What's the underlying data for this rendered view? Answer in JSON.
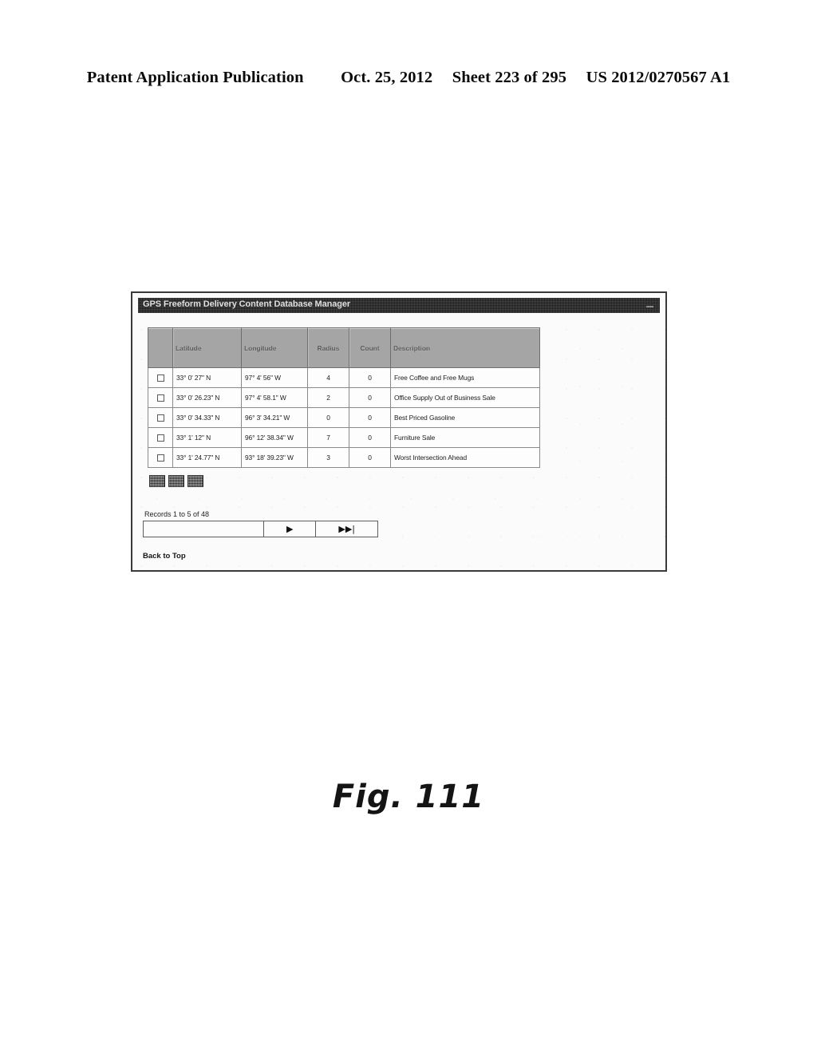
{
  "page_header": {
    "publication": "Patent Application Publication",
    "date": "Oct. 25, 2012",
    "sheet": "Sheet 223 of 295",
    "patent_number": "US 2012/0270567 A1"
  },
  "figure": {
    "caption": "Fig. 111"
  },
  "window": {
    "title": "GPS Freeform Delivery Content Database Manager",
    "minimize_icon": "minimize-icon"
  },
  "table": {
    "columns": [
      {
        "key": "select",
        "label": ""
      },
      {
        "key": "latitude",
        "label": "Latitude"
      },
      {
        "key": "longitude",
        "label": "Longitude"
      },
      {
        "key": "radius",
        "label": "Radius"
      },
      {
        "key": "count",
        "label": "Count"
      },
      {
        "key": "description",
        "label": "Description"
      }
    ],
    "rows": [
      {
        "checkbox": false,
        "latitude": "33° 0' 27\" N",
        "longitude": "97° 4' 56\" W",
        "radius": "4",
        "count": "0",
        "description": "Free Coffee and Free Mugs"
      },
      {
        "checkbox": false,
        "latitude": "33° 0' 26.23\" N",
        "longitude": "97° 4' 58.1\" W",
        "radius": "2",
        "count": "0",
        "description": "Office Supply Out of Business Sale"
      },
      {
        "checkbox": false,
        "latitude": "33° 0' 34.33\" N",
        "longitude": "96° 3' 34.21\" W",
        "radius": "0",
        "count": "0",
        "description": "Best Priced Gasoline"
      },
      {
        "checkbox": false,
        "latitude": "33° 1' 12\" N",
        "longitude": "96° 12' 38.34\" W",
        "radius": "7",
        "count": "0",
        "description": "Furniture Sale"
      },
      {
        "checkbox": false,
        "latitude": "33° 1' 24.77\" N",
        "longitude": "93° 18' 39.23\" W",
        "radius": "3",
        "count": "0",
        "description": "Worst Intersection Ahead"
      }
    ]
  },
  "toolbar": {
    "buttons": [
      {
        "name": "toolbar-icon-button-1"
      },
      {
        "name": "toolbar-icon-button-2"
      },
      {
        "name": "toolbar-icon-button-3"
      }
    ]
  },
  "pagination": {
    "records_text": "Records 1 to 5 of 48",
    "next_label": "▶",
    "last_label": "▶▶|"
  },
  "footer": {
    "back_to_top": "Back to Top"
  }
}
